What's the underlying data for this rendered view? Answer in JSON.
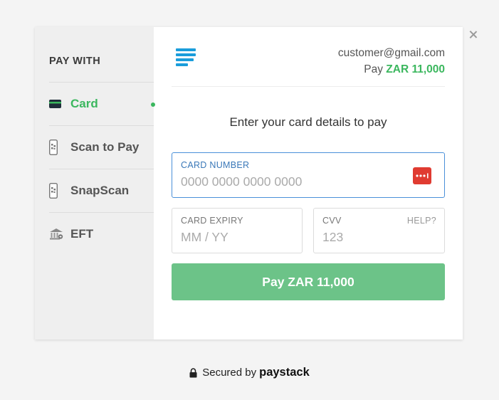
{
  "close_label": "×",
  "sidebar": {
    "title": "PAY WITH",
    "items": [
      {
        "label": "Card",
        "icon": "credit-card-icon",
        "active": true
      },
      {
        "label": "Scan to Pay",
        "icon": "phone-qr-icon",
        "active": false
      },
      {
        "label": "SnapScan",
        "icon": "phone-qr-icon",
        "active": false
      },
      {
        "label": "EFT",
        "icon": "bank-icon",
        "active": false
      }
    ]
  },
  "header": {
    "email": "customer@gmail.com",
    "pay_prefix": "Pay",
    "amount": "ZAR 11,000"
  },
  "form": {
    "prompt": "Enter your card details to pay",
    "card_number": {
      "label": "CARD NUMBER",
      "placeholder": "0000 0000 0000 0000",
      "value": ""
    },
    "card_expiry": {
      "label": "CARD EXPIRY",
      "placeholder": "MM / YY",
      "value": ""
    },
    "cvv": {
      "label": "CVV",
      "placeholder": "123",
      "help": "HELP?",
      "value": ""
    },
    "pay_button": "Pay ZAR 11,000"
  },
  "footer": {
    "secured_by": "Secured by",
    "brand": "paystack"
  },
  "colors": {
    "accent_green": "#3bb75e",
    "button_green": "#6cc388",
    "focus_blue": "#4a90d9",
    "logo_blue": "#1a9ddb",
    "card_brand_red": "#e03b31"
  }
}
